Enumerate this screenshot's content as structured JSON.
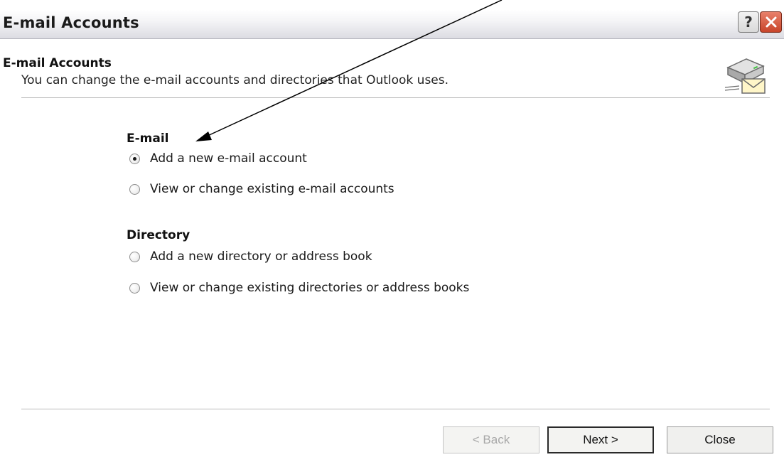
{
  "window": {
    "title": "E-mail Accounts",
    "help_symbol": "?"
  },
  "header": {
    "title": "E-mail Accounts",
    "description": "You can change the e-mail accounts and directories that Outlook uses.",
    "icon": "mail-server-icon"
  },
  "email_group": {
    "label": "E-mail",
    "options": [
      {
        "label": "Add a new e-mail account",
        "selected": true
      },
      {
        "label": "View or change existing e-mail accounts",
        "selected": false
      }
    ]
  },
  "directory_group": {
    "label": "Directory",
    "options": [
      {
        "label": "Add a new directory or address book",
        "selected": false
      },
      {
        "label": "View or change existing directories or address books",
        "selected": false
      }
    ]
  },
  "buttons": {
    "back": "< Back",
    "next": "Next >",
    "close": "Close"
  },
  "colors": {
    "close_button": "#c8452a",
    "annotation_arrow": "#000000"
  }
}
